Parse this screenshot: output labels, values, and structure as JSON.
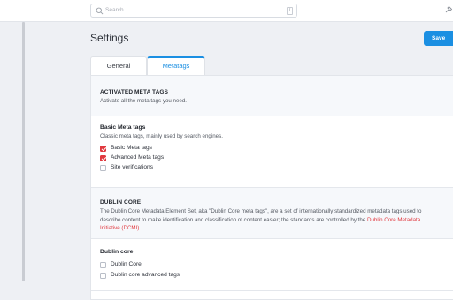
{
  "search": {
    "placeholder": "Search...",
    "shortcut": "/"
  },
  "page": {
    "title": "Settings",
    "save_label": "Save"
  },
  "tabs": [
    {
      "label": "General",
      "active": false
    },
    {
      "label": "Metatags",
      "active": true
    }
  ],
  "sections": {
    "activated": {
      "heading": "ACTIVATED META TAGS",
      "description": "Activate all the meta tags you need."
    },
    "basic": {
      "title": "Basic Meta tags",
      "description": "Classic meta tags, mainly used by search engines.",
      "options": [
        {
          "label": "Basic Meta tags",
          "checked": true
        },
        {
          "label": "Advanced Meta tags",
          "checked": true
        },
        {
          "label": "Site verifications",
          "checked": false
        }
      ]
    },
    "dublin": {
      "heading": "DUBLIN CORE",
      "description_line1": "The Dublin Core Metadata Element Set, aka \"Dublin Core meta tags\", are a set of internationally standardized metadata tags used to",
      "description_line2": "describe content to make identification and classification of content easier; the standards are controlled by the ",
      "description_link": "Dublin Core Metadata",
      "description_line3_link": "Initiative (DCMI)",
      "description_line3_end": "."
    },
    "dublin_core": {
      "title": "Dublin core",
      "options": [
        {
          "label": "Dublin Core",
          "checked": false
        },
        {
          "label": "Dublin core advanced tags",
          "checked": false
        }
      ]
    }
  },
  "colors": {
    "accent": "#1b8fe2",
    "checkbox_on": "#e0383e",
    "link": "#e0383e"
  }
}
